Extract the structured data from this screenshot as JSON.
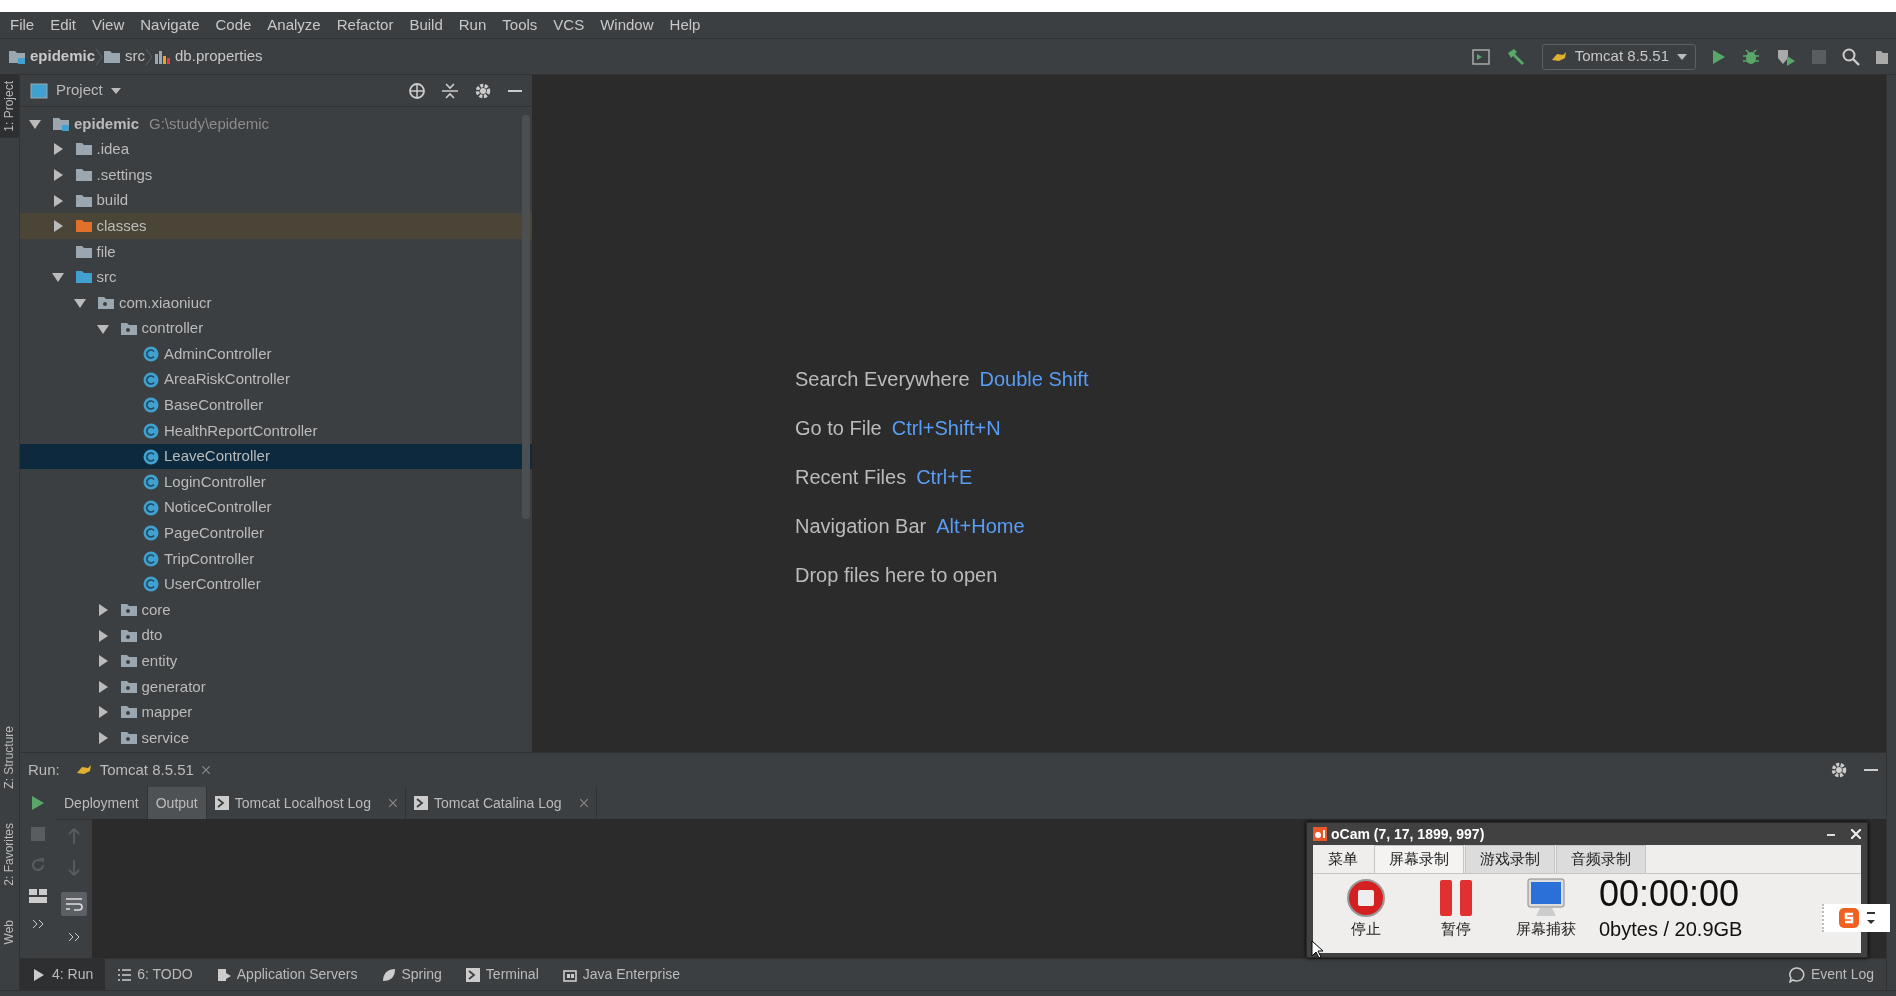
{
  "menu": [
    "File",
    "Edit",
    "View",
    "Navigate",
    "Code",
    "Analyze",
    "Refactor",
    "Build",
    "Run",
    "Tools",
    "VCS",
    "Window",
    "Help"
  ],
  "breadcrumbs": [
    {
      "label": "epidemic",
      "kind": "module"
    },
    {
      "label": "src",
      "kind": "folder"
    },
    {
      "label": "db.properties",
      "kind": "properties"
    }
  ],
  "run_config": {
    "label": "Tomcat 8.5.51"
  },
  "side_tabs": [
    {
      "label": "1: Project",
      "selected": true
    },
    {
      "label": "Z: Structure",
      "selected": false
    },
    {
      "label": "2: Favorites",
      "selected": false
    },
    {
      "label": "Web",
      "selected": false
    }
  ],
  "project_panel": {
    "title": "Project",
    "tree": [
      {
        "label": "epidemic",
        "note": "G:\\study\\epidemic",
        "kind": "module",
        "expanded": true,
        "selected": false,
        "children": [
          {
            "label": ".idea",
            "kind": "folder",
            "expanded": false,
            "selected": false
          },
          {
            "label": ".settings",
            "kind": "folder",
            "expanded": false,
            "selected": false
          },
          {
            "label": "build",
            "kind": "folder",
            "expanded": false,
            "selected": false
          },
          {
            "label": "classes",
            "kind": "excluded",
            "expanded": false,
            "selected": false
          },
          {
            "label": "file",
            "kind": "folder",
            "selected": false
          },
          {
            "label": "src",
            "kind": "source",
            "expanded": true,
            "selected": false,
            "children": [
              {
                "label": "com.xiaoniucr",
                "kind": "package",
                "expanded": true,
                "selected": false,
                "children": [
                  {
                    "label": "controller",
                    "kind": "package",
                    "expanded": true,
                    "selected": false,
                    "children": [
                      {
                        "label": "AdminController",
                        "kind": "class",
                        "selected": false
                      },
                      {
                        "label": "AreaRiskController",
                        "kind": "class",
                        "selected": false
                      },
                      {
                        "label": "BaseController",
                        "kind": "class",
                        "selected": false
                      },
                      {
                        "label": "HealthReportController",
                        "kind": "class",
                        "selected": false
                      },
                      {
                        "label": "LeaveController",
                        "kind": "class",
                        "selected": true
                      },
                      {
                        "label": "LoginController",
                        "kind": "class",
                        "selected": false
                      },
                      {
                        "label": "NoticeController",
                        "kind": "class",
                        "selected": false
                      },
                      {
                        "label": "PageController",
                        "kind": "class",
                        "selected": false
                      },
                      {
                        "label": "TripController",
                        "kind": "class",
                        "selected": false
                      },
                      {
                        "label": "UserController",
                        "kind": "class",
                        "selected": false
                      }
                    ]
                  },
                  {
                    "label": "core",
                    "kind": "package",
                    "expanded": false,
                    "selected": false
                  },
                  {
                    "label": "dto",
                    "kind": "package",
                    "expanded": false,
                    "selected": false
                  },
                  {
                    "label": "entity",
                    "kind": "package",
                    "expanded": false,
                    "selected": false
                  },
                  {
                    "label": "generator",
                    "kind": "package",
                    "expanded": false,
                    "selected": false
                  },
                  {
                    "label": "mapper",
                    "kind": "package",
                    "expanded": false,
                    "selected": false
                  },
                  {
                    "label": "service",
                    "kind": "package",
                    "expanded": false,
                    "selected": false
                  }
                ]
              }
            ]
          }
        ]
      }
    ]
  },
  "editor_hints": [
    {
      "action": "Search Everywhere",
      "shortcut": "Double Shift"
    },
    {
      "action": "Go to File",
      "shortcut": "Ctrl+Shift+N"
    },
    {
      "action": "Recent Files",
      "shortcut": "Ctrl+E"
    },
    {
      "action": "Navigation Bar",
      "shortcut": "Alt+Home"
    },
    {
      "action": "Drop files here to open"
    }
  ],
  "run_panel": {
    "label": "Run:",
    "session": "Tomcat 8.5.51",
    "tabs": [
      {
        "label": "Deployment",
        "selected": false,
        "closable": false
      },
      {
        "label": "Output",
        "selected": true,
        "closable": false
      },
      {
        "label": "Tomcat Localhost Log",
        "selected": false,
        "closable": true
      },
      {
        "label": "Tomcat Catalina Log",
        "selected": false,
        "closable": true
      }
    ]
  },
  "tool_windows": [
    {
      "label": "4: Run",
      "kind": "run",
      "selected": true
    },
    {
      "label": "6: TODO",
      "kind": "todo",
      "selected": false
    },
    {
      "label": "Application Servers",
      "kind": "servers",
      "selected": false
    },
    {
      "label": "Spring",
      "kind": "spring",
      "selected": false
    },
    {
      "label": "Terminal",
      "kind": "terminal",
      "selected": false
    },
    {
      "label": "Java Enterprise",
      "kind": "enterprise",
      "selected": false
    }
  ],
  "event_log": "Event Log",
  "ocam": {
    "title": "oCam (7, 17, 1899, 997)",
    "tabs": [
      {
        "label": "菜单",
        "selected": false
      },
      {
        "label": "屏幕录制",
        "selected": true
      },
      {
        "label": "游戏录制",
        "selected": false
      },
      {
        "label": "音频录制",
        "selected": false
      }
    ],
    "actions": [
      {
        "label": "停止",
        "kind": "stop"
      },
      {
        "label": "暂停",
        "kind": "pause"
      },
      {
        "label": "屏幕捕获",
        "kind": "capture"
      }
    ],
    "timer": "00:00:00",
    "storage": "0bytes / 20.9GB"
  }
}
